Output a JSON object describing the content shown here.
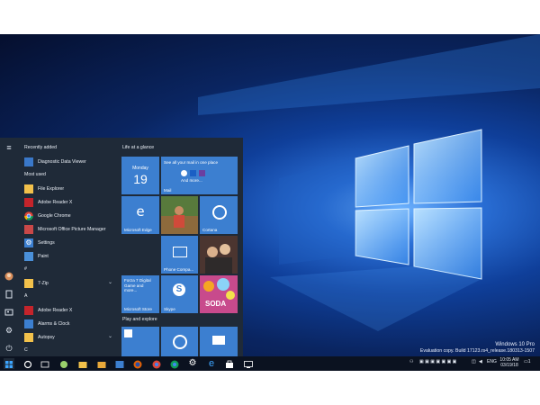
{
  "desktop": {
    "watermark_line1": "Windows 10 Pro",
    "watermark_line2": "Evaluation copy. Build 17123.rs4_release.180313-1507"
  },
  "start_menu": {
    "recently_added_header": "Recently added",
    "most_used_header": "Most used",
    "recent": [
      {
        "label": "Diagnostic Data Viewer",
        "icon": "diagnostic-icon",
        "color": "#3a78c9"
      }
    ],
    "most_used": [
      {
        "label": "File Explorer",
        "icon": "folder-icon",
        "color": "#f2c14b"
      },
      {
        "label": "Adobe Reader X",
        "icon": "adobe-reader-icon",
        "color": "#c4242b"
      },
      {
        "label": "Google Chrome",
        "icon": "chrome-icon",
        "color": "#ffffff"
      },
      {
        "label": "Microsoft Office Picture Manager",
        "icon": "picture-manager-icon",
        "color": "#c94848"
      },
      {
        "label": "Settings",
        "icon": "gear-icon",
        "color": "#3c7fd0"
      },
      {
        "label": "Paint",
        "icon": "paint-icon",
        "color": "#4a90d9"
      }
    ],
    "hash_header": "#",
    "hash_items": [
      {
        "label": "7-Zip",
        "icon": "folder-icon",
        "color": "#f2c14b"
      }
    ],
    "a_header": "A",
    "a_items": [
      {
        "label": "Adobe Reader X",
        "icon": "adobe-reader-icon",
        "color": "#c4242b"
      },
      {
        "label": "Alarms & Clock",
        "icon": "alarm-icon",
        "color": "#3c7fd0"
      },
      {
        "label": "Autopsy",
        "icon": "folder-icon",
        "color": "#f2c14b"
      }
    ],
    "c_header": "C",
    "life_header": "Life at a glance",
    "play_header": "Play and explore",
    "tiles": {
      "calendar_day": "Monday",
      "calendar_date": "19",
      "mail_text": "See all your mail in one place",
      "mail_more": "And more...",
      "mail_label": "Mail",
      "edge_label": "Microsoft Edge",
      "cortana_label": "Cortana",
      "phone_label": "Phone Compa...",
      "forza_text": "Forza 7 Digital Game and more...",
      "store_label": "Microsoft Store",
      "skype_label": "Skype",
      "candy_label": "SODA"
    }
  },
  "taskbar": {
    "lang": "ENG",
    "time": "10:05 AM",
    "date": "03/19/18",
    "notification_count": "1"
  },
  "colors": {
    "start_bg": "#1f2a38",
    "tile_blue": "#3c7fd0",
    "taskbar_bg": "#0b1220"
  }
}
